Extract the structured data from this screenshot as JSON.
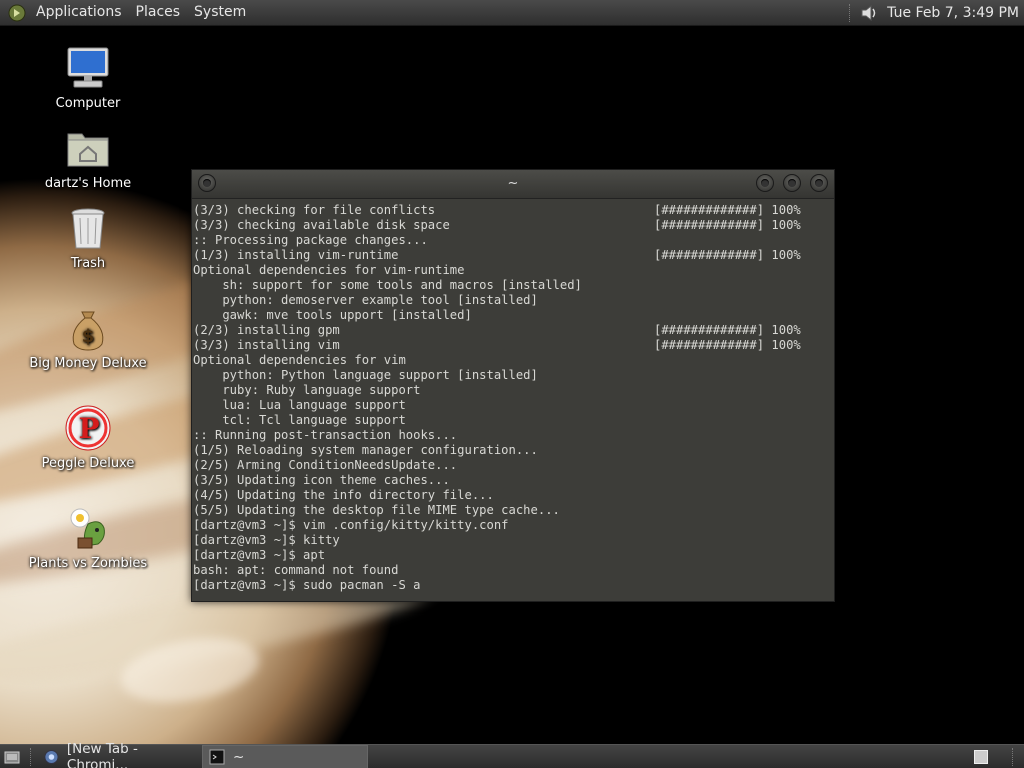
{
  "top_panel": {
    "menus": [
      "Applications",
      "Places",
      "System"
    ],
    "clock": "Tue Feb  7,  3:49 PM"
  },
  "desktop_icons": [
    {
      "label": "Computer",
      "icon": "computer-icon"
    },
    {
      "label": "dartz's Home",
      "icon": "home-folder-icon"
    },
    {
      "label": "Trash",
      "icon": "trash-icon"
    },
    {
      "label": "Big Money Deluxe",
      "icon": "money-bag-icon"
    },
    {
      "label": "Peggle Deluxe",
      "icon": "peggle-icon"
    },
    {
      "label": "Plants vs Zombies",
      "icon": "plants-vs-zombies-icon"
    }
  ],
  "terminal": {
    "title": "~",
    "lines": [
      {
        "text": "(3/3) checking for file conflicts",
        "progress": "[#############] 100%"
      },
      {
        "text": "(3/3) checking available disk space",
        "progress": "[#############] 100%"
      },
      {
        "text": ":: Processing package changes..."
      },
      {
        "text": "(1/3) installing vim-runtime",
        "progress": "[#############] 100%"
      },
      {
        "text": "Optional dependencies for vim-runtime"
      },
      {
        "text": "    sh: support for some tools and macros [installed]"
      },
      {
        "text": "    python: demoserver example tool [installed]"
      },
      {
        "text": "    gawk: mve tools upport [installed]"
      },
      {
        "text": "(2/3) installing gpm",
        "progress": "[#############] 100%"
      },
      {
        "text": "(3/3) installing vim",
        "progress": "[#############] 100%"
      },
      {
        "text": "Optional dependencies for vim"
      },
      {
        "text": "    python: Python language support [installed]"
      },
      {
        "text": "    ruby: Ruby language support"
      },
      {
        "text": "    lua: Lua language support"
      },
      {
        "text": "    tcl: Tcl language support"
      },
      {
        "text": ":: Running post-transaction hooks..."
      },
      {
        "text": "(1/5) Reloading system manager configuration..."
      },
      {
        "text": "(2/5) Arming ConditionNeedsUpdate..."
      },
      {
        "text": "(3/5) Updating icon theme caches..."
      },
      {
        "text": "(4/5) Updating the info directory file..."
      },
      {
        "text": "(5/5) Updating the desktop file MIME type cache..."
      },
      {
        "text": "[dartz@vm3 ~]$ vim .config/kitty/kitty.conf"
      },
      {
        "text": "[dartz@vm3 ~]$ kitty"
      },
      {
        "text": "[dartz@vm3 ~]$ apt"
      },
      {
        "text": "bash: apt: command not found"
      },
      {
        "text": "[dartz@vm3 ~]$ sudo pacman -S a"
      }
    ]
  },
  "taskbar": {
    "tasks": [
      {
        "label": "[New Tab - Chromi...",
        "icon": "chromium-icon",
        "active": false
      },
      {
        "label": "~",
        "icon": "terminal-icon",
        "active": true
      }
    ]
  }
}
